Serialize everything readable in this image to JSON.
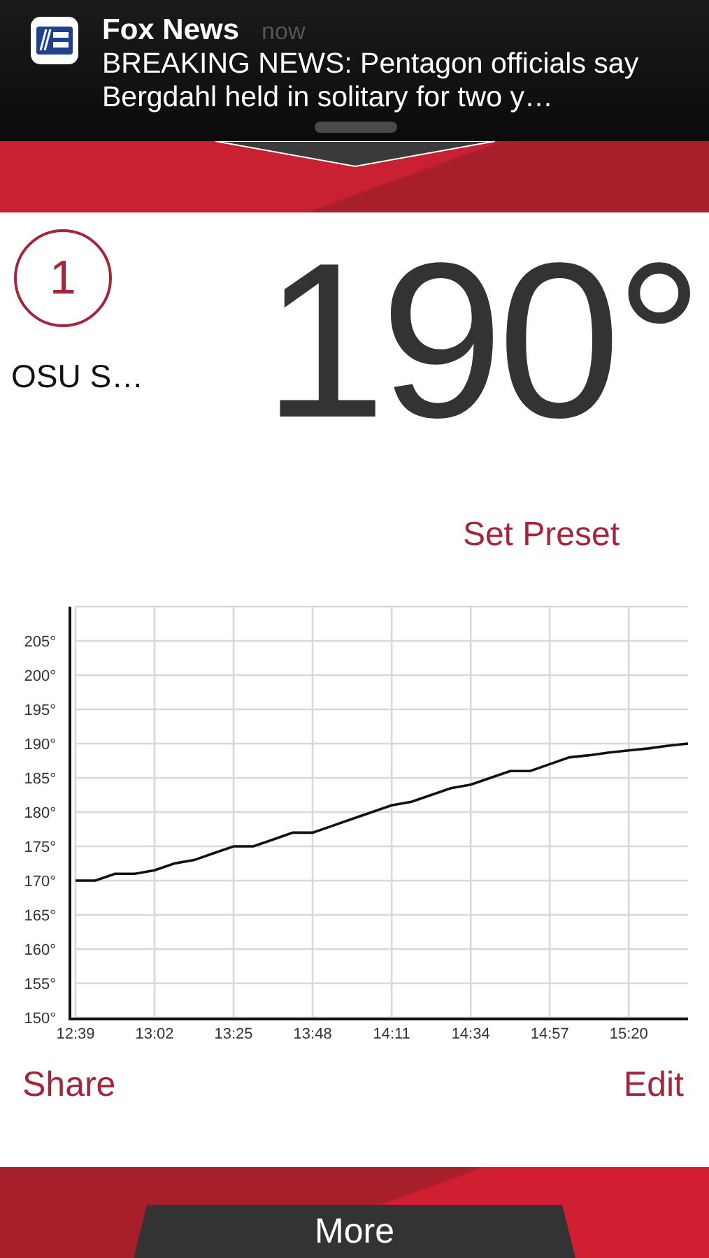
{
  "notification": {
    "app": "Fox News",
    "time": "now",
    "message": "BREAKING NEWS: Pentagon officials say Bergdahl held in solitary for two y…"
  },
  "probe": {
    "number": "1",
    "name": "OSU S…",
    "temperature": "190°"
  },
  "set_preset": "Set Preset",
  "chart": {
    "chart_data": {
      "type": "line",
      "ylim": [
        150,
        210
      ],
      "grid": true,
      "yticks": [
        {
          "value": 150,
          "label": "150°"
        },
        {
          "value": 155,
          "label": "155°"
        },
        {
          "value": 160,
          "label": "160°"
        },
        {
          "value": 165,
          "label": "165°"
        },
        {
          "value": 170,
          "label": "170°"
        },
        {
          "value": 175,
          "label": "175°"
        },
        {
          "value": 180,
          "label": "180°"
        },
        {
          "value": 185,
          "label": "185°"
        },
        {
          "value": 190,
          "label": "190°"
        },
        {
          "value": 195,
          "label": "195°"
        },
        {
          "value": 200,
          "label": "200°"
        },
        {
          "value": 205,
          "label": "205°"
        }
      ],
      "categories": [
        "12:39",
        null,
        null,
        null,
        "13:02",
        null,
        null,
        null,
        "13:25",
        null,
        null,
        null,
        "13:48",
        null,
        null,
        null,
        "14:11",
        null,
        null,
        null,
        "14:34",
        null,
        null,
        null,
        "14:57",
        null,
        null,
        null,
        "15:20",
        null,
        null,
        null
      ],
      "series": [
        {
          "color": "#111111",
          "values": [
            170,
            170,
            171,
            171,
            171.5,
            172.5,
            173,
            174,
            175,
            175,
            176,
            177,
            177,
            178,
            179,
            180,
            181,
            181.5,
            182.5,
            183.5,
            184,
            185,
            186,
            186,
            187,
            188,
            188.3,
            188.7,
            189,
            189.3,
            189.7,
            190
          ]
        }
      ]
    }
  },
  "actions": [
    {
      "label": "Share"
    },
    {
      "label": "Edit"
    }
  ],
  "more": "More"
}
